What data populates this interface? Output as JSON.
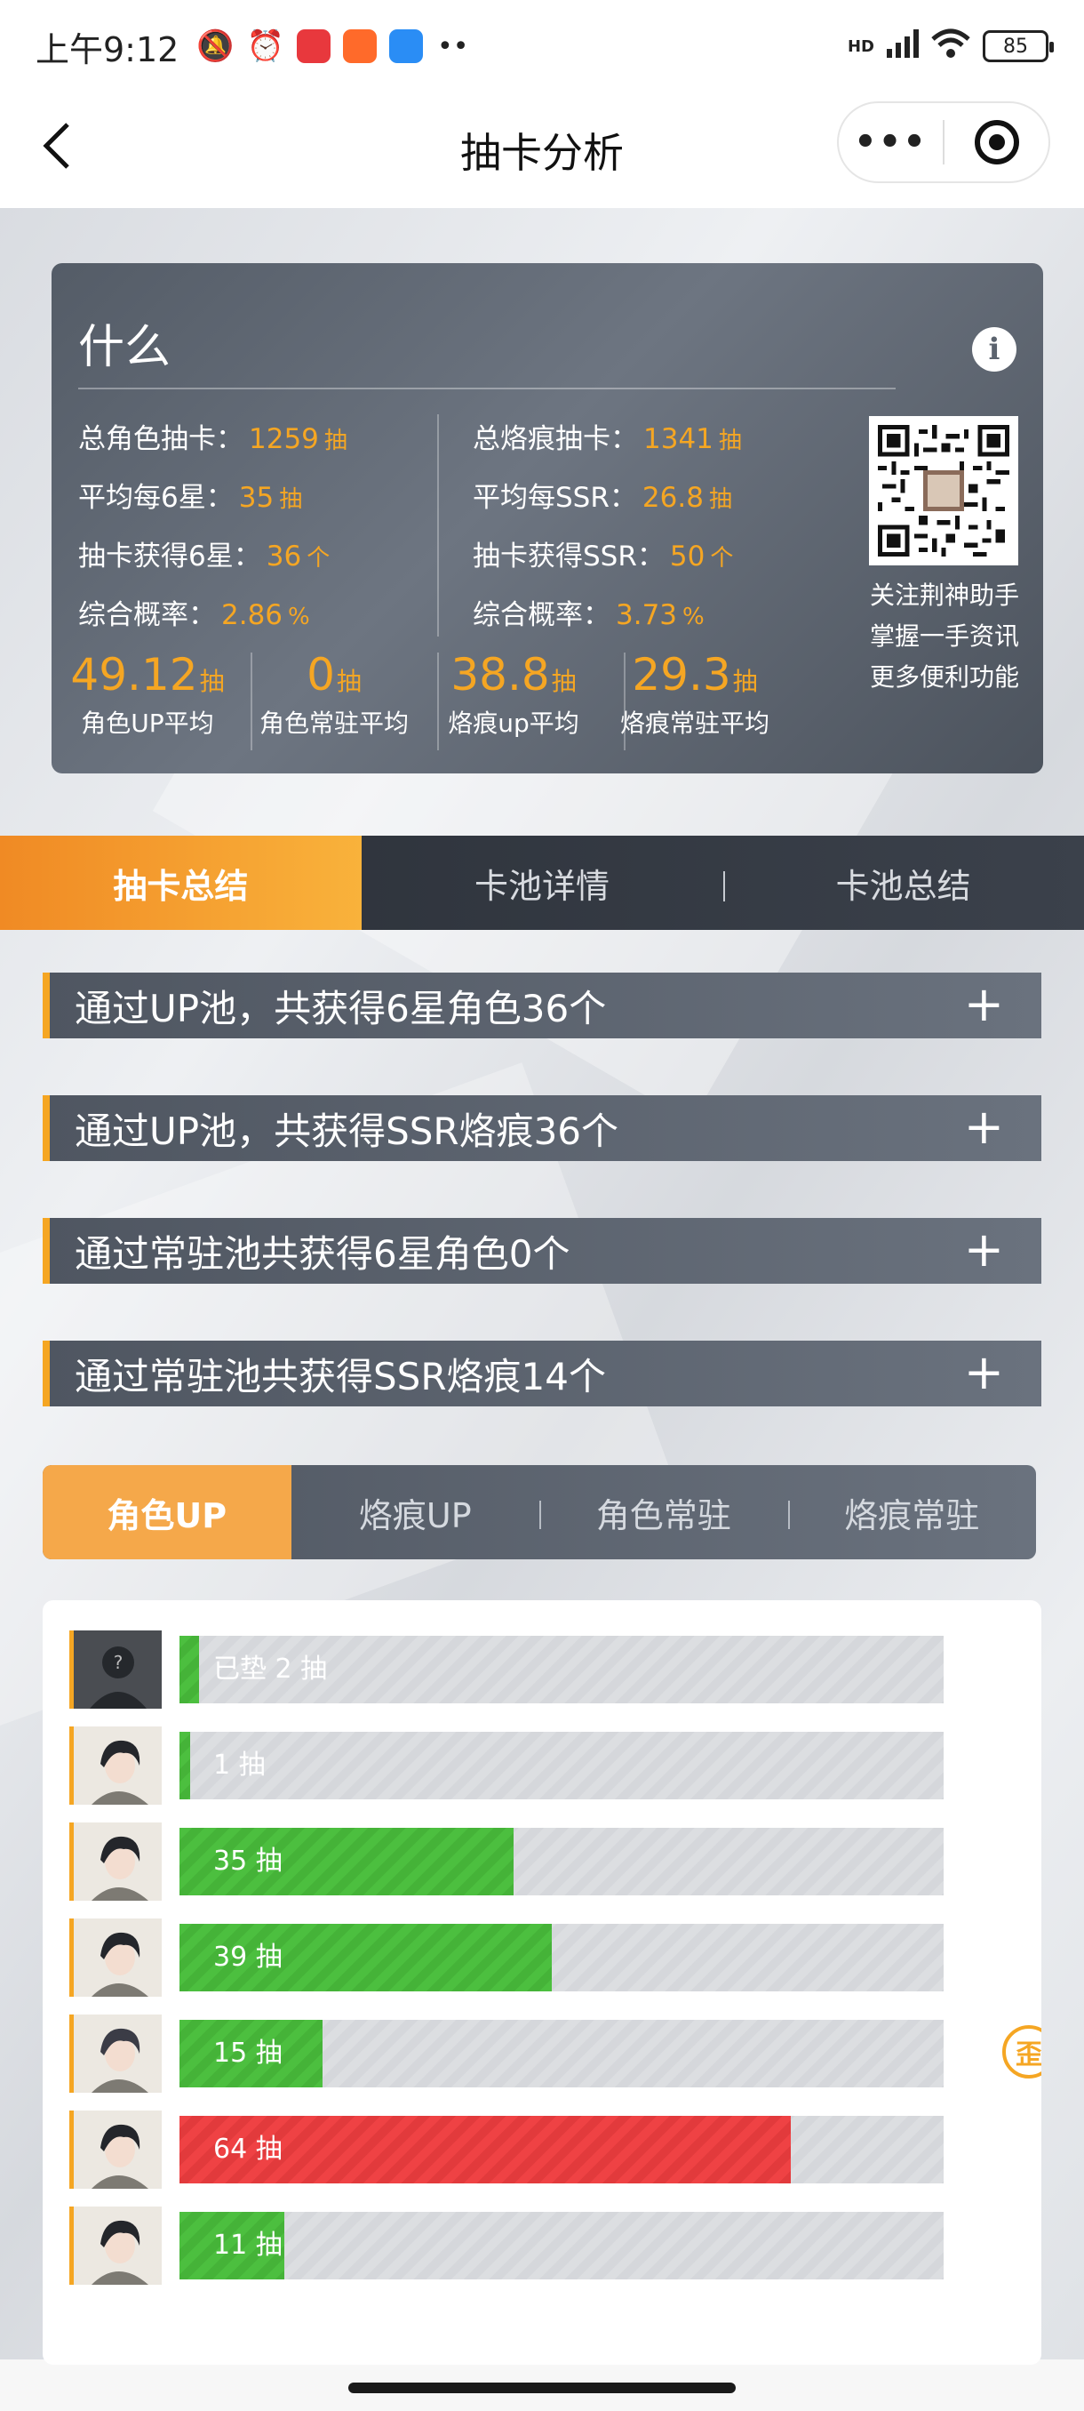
{
  "status_bar": {
    "time": "上午9:12",
    "battery": "85",
    "network": "HD"
  },
  "nav": {
    "back_label": "<",
    "title": "抽卡分析",
    "more_label": "•••"
  },
  "summary": {
    "title": "什么",
    "left_stats": [
      {
        "label": "总角色抽卡：",
        "value": "1259",
        "unit": "抽"
      },
      {
        "label": "平均每6星：",
        "value": "35",
        "unit": "抽"
      },
      {
        "label": "抽卡获得6星：",
        "value": "36",
        "unit": "个"
      },
      {
        "label": "综合概率：",
        "value": "2.86",
        "unit": "%"
      }
    ],
    "right_stats": [
      {
        "label": "总烙痕抽卡：",
        "value": "1341",
        "unit": "抽"
      },
      {
        "label": "平均每SSR：",
        "value": "26.8",
        "unit": "抽"
      },
      {
        "label": "抽卡获得SSR：",
        "value": "50",
        "unit": "个"
      },
      {
        "label": "综合概率：",
        "value": "3.73",
        "unit": "%"
      }
    ],
    "follow_lines": [
      "关注荆神助手",
      "掌握一手资讯",
      "更多便利功能"
    ],
    "averages": [
      {
        "num": "49.12",
        "unit": "抽",
        "label": "角色UP平均"
      },
      {
        "num": "0",
        "unit": "抽",
        "label": "角色常驻平均"
      },
      {
        "num": "38.8",
        "unit": "抽",
        "label": "烙痕up平均"
      },
      {
        "num": "29.3",
        "unit": "抽",
        "label": "烙痕常驻平均"
      }
    ]
  },
  "main_tabs": [
    "抽卡总结",
    "卡池详情",
    "卡池总结"
  ],
  "accordion": [
    {
      "label": "通过UP池，共获得6星角色36个"
    },
    {
      "label": "通过UP池，共获得SSR烙痕36个"
    },
    {
      "label": "通过常驻池共获得6星角色0个"
    },
    {
      "label": "通过常驻池共获得SSR烙痕14个"
    }
  ],
  "plus_label": "+",
  "sub_tabs": [
    "角色UP",
    "烙痕UP",
    "角色常驻",
    "烙痕常驻"
  ],
  "pulls": {
    "scale_max": 80,
    "rows": [
      {
        "text": "已垫 2 抽",
        "value": 2,
        "color": "green",
        "avatar": "unknown",
        "badge": ""
      },
      {
        "text": "1 抽",
        "value": 1,
        "color": "green",
        "avatar": "character",
        "badge": ""
      },
      {
        "text": "35 抽",
        "value": 35,
        "color": "green",
        "avatar": "character",
        "badge": ""
      },
      {
        "text": "39 抽",
        "value": 39,
        "color": "green",
        "avatar": "character",
        "badge": ""
      },
      {
        "text": "15 抽",
        "value": 15,
        "color": "green",
        "avatar": "character-alt",
        "badge": "歪"
      },
      {
        "text": "64 抽",
        "value": 64,
        "color": "red",
        "avatar": "character",
        "badge": ""
      },
      {
        "text": "11 抽",
        "value": 11,
        "color": "green",
        "avatar": "character",
        "badge": ""
      }
    ]
  },
  "colors": {
    "accent": "#f5a623",
    "green": "#4cbf3f",
    "red": "#ef4244",
    "card": "#5b636e"
  }
}
